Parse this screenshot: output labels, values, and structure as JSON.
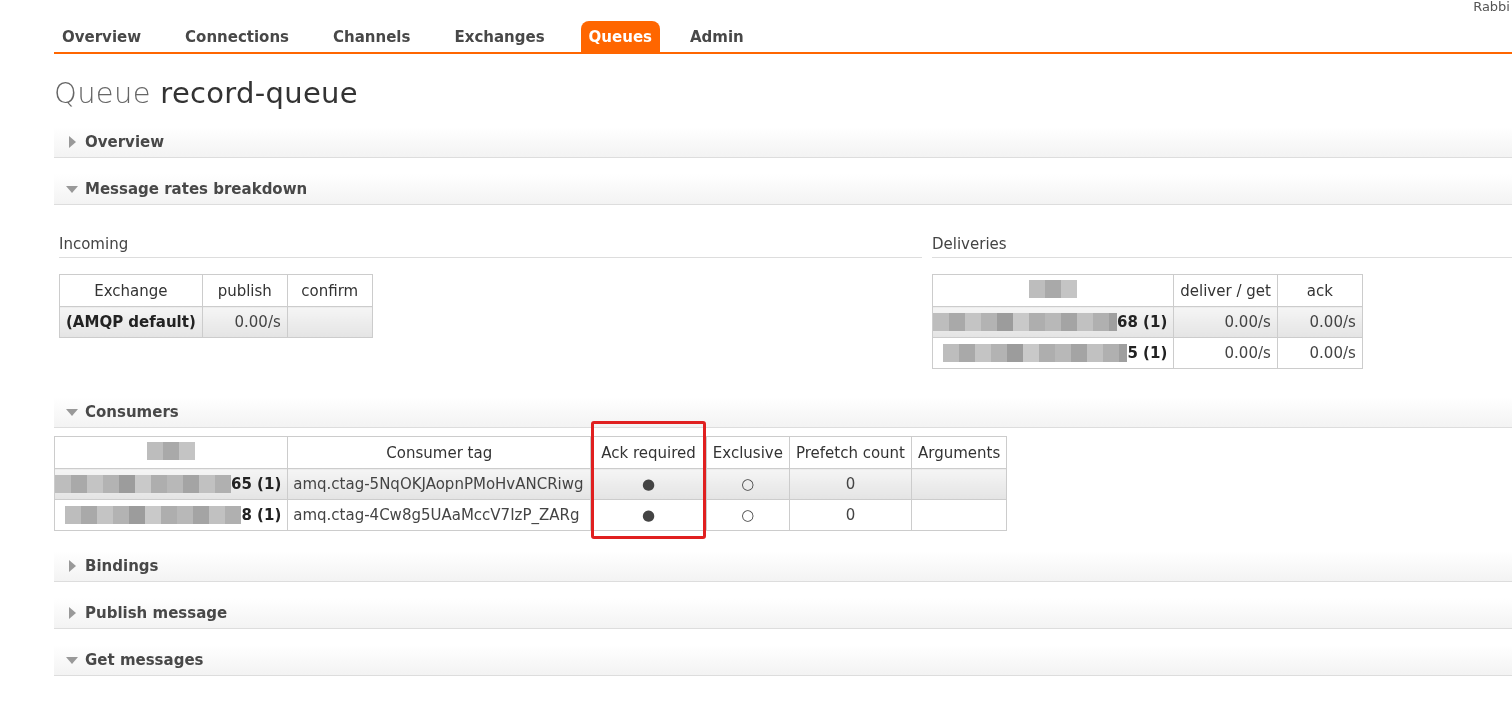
{
  "corner_text": "Rabbi",
  "tabs": [
    {
      "label": "Overview",
      "selected": false
    },
    {
      "label": "Connections",
      "selected": false
    },
    {
      "label": "Channels",
      "selected": false
    },
    {
      "label": "Exchanges",
      "selected": false
    },
    {
      "label": "Queues",
      "selected": true
    },
    {
      "label": "Admin",
      "selected": false
    }
  ],
  "title": {
    "kind_label": "Queue",
    "name": "record-queue"
  },
  "sections": [
    {
      "title": "Overview",
      "expanded": false
    },
    {
      "kind": "rates",
      "title": "Message rates breakdown",
      "expanded": true,
      "incoming": {
        "heading": "Incoming",
        "columns": [
          "Exchange",
          "publish",
          "confirm"
        ],
        "rows": [
          [
            "(AMQP default)",
            "0.00/s",
            ""
          ]
        ]
      },
      "deliveries": {
        "heading": "Deliveries",
        "columns": [
          "deliver / get",
          "ack"
        ],
        "rows": [
          {
            "channel": "68 (1)",
            "cells": [
              "0.00/s",
              "0.00/s"
            ]
          },
          {
            "channel": "5 (1)",
            "cells": [
              "0.00/s",
              "0.00/s"
            ]
          }
        ]
      }
    },
    {
      "kind": "consumers",
      "title": "Consumers",
      "expanded": true,
      "columns": [
        {
          "label": "Consumer tag",
          "highlighted": false
        },
        {
          "label": "Ack required",
          "highlighted": true
        },
        {
          "label": "Exclusive",
          "highlighted": false
        },
        {
          "label": "Prefetch count",
          "highlighted": false
        },
        {
          "label": "Arguments",
          "highlighted": false
        }
      ],
      "rows": [
        {
          "channel": "65 (1)",
          "cells": [
            "amq.ctag-5NqOKJAopnPMoHvANCRiwg",
            "●",
            "○",
            "0",
            ""
          ]
        },
        {
          "channel": "8 (1)",
          "cells": [
            "amq.ctag-4Cw8g5UAaMccV7IzP_ZARg",
            "●",
            "○",
            "0",
            ""
          ]
        }
      ]
    },
    {
      "title": "Bindings",
      "expanded": false
    },
    {
      "title": "Publish message",
      "expanded": false
    },
    {
      "title": "Get messages",
      "expanded": true
    }
  ]
}
